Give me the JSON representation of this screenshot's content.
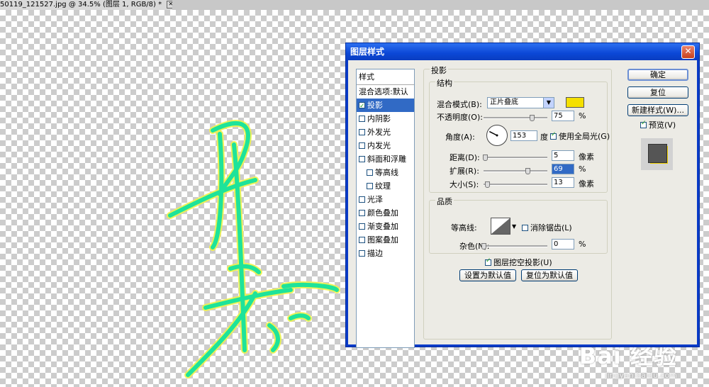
{
  "document": {
    "tab_title": "50119_121527.jpg @ 34.5% (图层 1, RGB/8) *",
    "close_label": "✕"
  },
  "dialog": {
    "title": "图层样式",
    "close_label": "✕",
    "style_list": {
      "header": "样式",
      "items": [
        {
          "label": "混合选项:默认",
          "checkbox": false,
          "checked": false,
          "selected": false,
          "sub": false
        },
        {
          "label": "投影",
          "checkbox": true,
          "checked": true,
          "selected": true,
          "sub": false
        },
        {
          "label": "内阴影",
          "checkbox": true,
          "checked": false,
          "selected": false,
          "sub": false
        },
        {
          "label": "外发光",
          "checkbox": true,
          "checked": false,
          "selected": false,
          "sub": false
        },
        {
          "label": "内发光",
          "checkbox": true,
          "checked": false,
          "selected": false,
          "sub": false
        },
        {
          "label": "斜面和浮雕",
          "checkbox": true,
          "checked": false,
          "selected": false,
          "sub": false
        },
        {
          "label": "等高线",
          "checkbox": true,
          "checked": false,
          "selected": false,
          "sub": true
        },
        {
          "label": "纹理",
          "checkbox": true,
          "checked": false,
          "selected": false,
          "sub": true
        },
        {
          "label": "光泽",
          "checkbox": true,
          "checked": false,
          "selected": false,
          "sub": false
        },
        {
          "label": "颜色叠加",
          "checkbox": true,
          "checked": false,
          "selected": false,
          "sub": false
        },
        {
          "label": "渐变叠加",
          "checkbox": true,
          "checked": false,
          "selected": false,
          "sub": false
        },
        {
          "label": "图案叠加",
          "checkbox": true,
          "checked": false,
          "selected": false,
          "sub": false
        },
        {
          "label": "描边",
          "checkbox": true,
          "checked": false,
          "selected": false,
          "sub": false
        }
      ]
    },
    "drop_shadow": {
      "section_title": "投影",
      "structure": {
        "title": "结构",
        "blend_mode_label": "混合模式(B):",
        "blend_mode_value": "正片叠底",
        "shadow_color": "#f5e000",
        "opacity_label": "不透明度(O):",
        "opacity_value": "75",
        "opacity_unit": "%",
        "opacity_fraction": 0.75,
        "angle_label": "角度(A):",
        "angle_value": "153",
        "angle_unit": "度",
        "global_light_label": "使用全局光(G)",
        "global_light_checked": true,
        "distance_label": "距离(D):",
        "distance_value": "5",
        "distance_unit": "像素",
        "distance_fraction": 0.02,
        "spread_label": "扩展(R):",
        "spread_value": "69",
        "spread_unit": "%",
        "spread_fraction": 0.69,
        "size_label": "大小(S):",
        "size_value": "13",
        "size_unit": "像素",
        "size_fraction": 0.05
      },
      "quality": {
        "title": "品质",
        "contour_label": "等高线:",
        "anti_alias_label": "消除锯齿(L)",
        "anti_alias_checked": false,
        "noise_label": "杂色(N):",
        "noise_value": "0",
        "noise_unit": "%",
        "noise_fraction": 0.0
      },
      "knockout_label": "图层挖空投影(U)",
      "knockout_checked": true,
      "make_default_label": "设置为默认值",
      "reset_default_label": "复位为默认值"
    },
    "buttons": {
      "ok": "确定",
      "reset": "复位",
      "new_style": "新建样式(W)...",
      "preview_label": "预览(V)",
      "preview_checked": true
    }
  },
  "watermark": {
    "brand": "Bai 经验",
    "url": "jingyan.baidu.com"
  },
  "colors": {
    "signature_stroke": "#1ee39a",
    "signature_glow": "#eef24a",
    "selection": "#316ac5"
  }
}
